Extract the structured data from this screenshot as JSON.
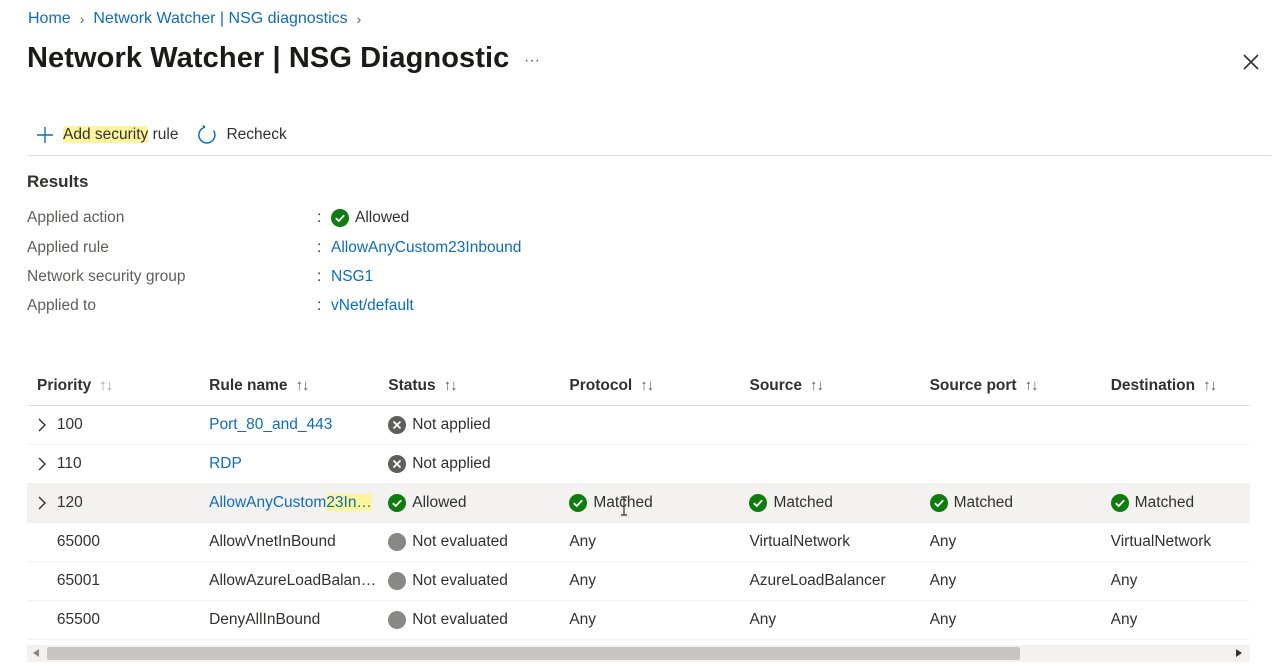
{
  "breadcrumb": {
    "home": "Home",
    "parent": "Network Watcher | NSG diagnostics"
  },
  "title": "Network Watcher | NSG Diagnostic",
  "more": "···",
  "toolbar": {
    "add_hl": "Add security",
    "add_rest": " rule",
    "recheck": "Recheck"
  },
  "results": {
    "heading": "Results",
    "applied_action_label": "Applied action",
    "applied_action_value": "Allowed",
    "applied_rule_label": "Applied rule",
    "applied_rule_value": "AllowAnyCustom23Inbound",
    "nsg_label": "Network security group",
    "nsg_value": "NSG1",
    "applied_to_label": "Applied to",
    "applied_to_value": "vNet/default",
    "colon": ":"
  },
  "grid": {
    "headers": {
      "priority": "Priority",
      "rule_name": "Rule name",
      "status": "Status",
      "protocol": "Protocol",
      "source": "Source",
      "source_port": "Source port",
      "destination": "Destination",
      "sort": "↑↓"
    },
    "rows": [
      {
        "priority": "100",
        "rule_name": "Port_80_and_443",
        "status": "Not applied",
        "protocol": "",
        "source": "",
        "source_port": "",
        "destination": ""
      },
      {
        "priority": "110",
        "rule_name": "RDP",
        "status": "Not applied",
        "protocol": "",
        "source": "",
        "source_port": "",
        "destination": ""
      },
      {
        "priority": "120",
        "rule_name_a": "AllowAnyCustom",
        "rule_name_b": "23In…",
        "status": "Allowed",
        "protocol": "Matched",
        "source": "Matched",
        "source_port": "Matched",
        "destination": "Matched"
      },
      {
        "priority": "65000",
        "rule_name": "AllowVnetInBound",
        "status": "Not evaluated",
        "protocol": "Any",
        "source": "VirtualNetwork",
        "source_port": "Any",
        "destination": "VirtualNetwork"
      },
      {
        "priority": "65001",
        "rule_name": "AllowAzureLoadBalan…",
        "status": "Not evaluated",
        "protocol": "Any",
        "source": "AzureLoadBalancer",
        "source_port": "Any",
        "destination": "Any"
      },
      {
        "priority": "65500",
        "rule_name": "DenyAllInBound",
        "status": "Not evaluated",
        "protocol": "Any",
        "source": "Any",
        "source_port": "Any",
        "destination": "Any"
      }
    ]
  },
  "icons": {
    "close": "close-icon",
    "plus": "plus-icon",
    "refresh": "refresh-icon",
    "check": "check-circle-icon",
    "x": "x-circle-icon",
    "grey": "grey-dot-icon",
    "chevron": "chevron-right-icon"
  },
  "colors": {
    "link": "#0f6cbd",
    "success": "#107c10",
    "failure": "#605e5c",
    "highlight": "#fdf59b"
  }
}
